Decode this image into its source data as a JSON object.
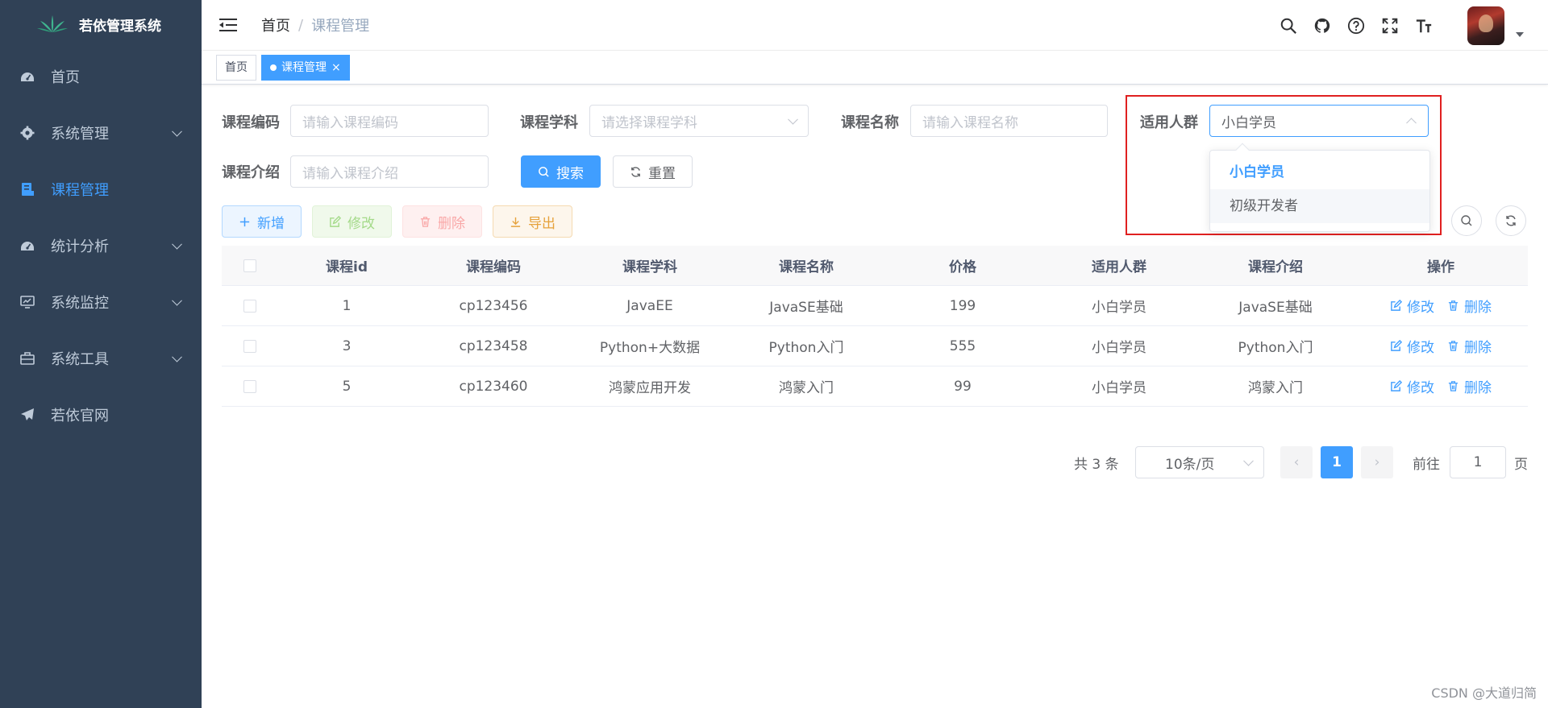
{
  "app": {
    "title": "若依管理系统"
  },
  "sidebar": {
    "items": [
      {
        "label": "首页",
        "icon": "dashboard-icon",
        "has_children": false,
        "active": false
      },
      {
        "label": "系统管理",
        "icon": "gear-icon",
        "has_children": true,
        "active": false
      },
      {
        "label": "课程管理",
        "icon": "course-icon",
        "has_children": false,
        "active": true
      },
      {
        "label": "统计分析",
        "icon": "dashboard-icon",
        "has_children": true,
        "active": false
      },
      {
        "label": "系统监控",
        "icon": "monitor-icon",
        "has_children": true,
        "active": false
      },
      {
        "label": "系统工具",
        "icon": "toolbox-icon",
        "has_children": true,
        "active": false
      },
      {
        "label": "若依官网",
        "icon": "send-icon",
        "has_children": false,
        "active": false
      }
    ]
  },
  "breadcrumb": {
    "home": "首页",
    "separator": "/",
    "current": "课程管理"
  },
  "tags": {
    "home": "首页",
    "current": "课程管理",
    "close": "×"
  },
  "form": {
    "code_label": "课程编码",
    "code_placeholder": "请输入课程编码",
    "subject_label": "课程学科",
    "subject_placeholder": "请选择课程学科",
    "name_label": "课程名称",
    "name_placeholder": "请输入课程名称",
    "audience_label": "适用人群",
    "audience_value": "小白学员",
    "intro_label": "课程介绍",
    "intro_placeholder": "请输入课程介绍",
    "search_label": "搜索",
    "reset_label": "重置"
  },
  "dropdown": {
    "options": [
      "小白学员",
      "初级开发者"
    ],
    "selected": "小白学员"
  },
  "toolbar": {
    "add": "新增",
    "edit": "修改",
    "delete": "删除",
    "export": "导出"
  },
  "table": {
    "columns": [
      "课程id",
      "课程编码",
      "课程学科",
      "课程名称",
      "价格",
      "适用人群",
      "课程介绍",
      "操作"
    ],
    "rows": [
      {
        "id": "1",
        "code": "cp123456",
        "subject": "JavaEE",
        "name": "JavaSE基础",
        "price": "199",
        "audience": "小白学员",
        "intro": "JavaSE基础"
      },
      {
        "id": "3",
        "code": "cp123458",
        "subject": "Python+大数据",
        "name": "Python入门",
        "price": "555",
        "audience": "小白学员",
        "intro": "Python入门"
      },
      {
        "id": "5",
        "code": "cp123460",
        "subject": "鸿蒙应用开发",
        "name": "鸿蒙入门",
        "price": "99",
        "audience": "小白学员",
        "intro": "鸿蒙入门"
      }
    ],
    "op_edit": "修改",
    "op_delete": "删除"
  },
  "pagination": {
    "total_text": "共 3 条",
    "page_size": "10条/页",
    "prev": "‹",
    "current_page": "1",
    "next": "›",
    "goto_label": "前往",
    "goto_value": "1",
    "page_suffix": "页"
  },
  "watermark": "CSDN @大道归简",
  "colors": {
    "sidebar_bg": "#304156",
    "primary": "#409eff",
    "highlight": "#e02020"
  }
}
